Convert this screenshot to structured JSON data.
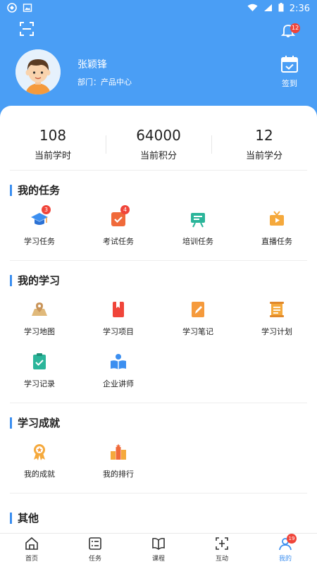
{
  "status_bar": {
    "time": "2:36"
  },
  "header": {
    "user_name": "张颖锋",
    "department": "部门：产品中心",
    "checkin_label": "签到",
    "notification_count": "12"
  },
  "stats": [
    {
      "value": "108",
      "label": "当前学时"
    },
    {
      "value": "64000",
      "label": "当前积分"
    },
    {
      "value": "12",
      "label": "当前学分"
    }
  ],
  "sections": {
    "tasks": {
      "title": "我的任务",
      "items": [
        {
          "label": "学习任务",
          "icon": "graduation-cap-icon",
          "badge": "3"
        },
        {
          "label": "考试任务",
          "icon": "exam-check-icon",
          "badge": "4"
        },
        {
          "label": "培训任务",
          "icon": "training-board-icon"
        },
        {
          "label": "直播任务",
          "icon": "live-tv-icon"
        }
      ]
    },
    "learning": {
      "title": "我的学习",
      "items": [
        {
          "label": "学习地图",
          "icon": "map-icon"
        },
        {
          "label": "学习项目",
          "icon": "project-book-icon"
        },
        {
          "label": "学习笔记",
          "icon": "notes-pen-icon"
        },
        {
          "label": "学习计划",
          "icon": "plan-scroll-icon"
        },
        {
          "label": "学习记录",
          "icon": "record-clipboard-icon"
        },
        {
          "label": "企业讲师",
          "icon": "lecturer-icon"
        }
      ]
    },
    "achievements": {
      "title": "学习成就",
      "items": [
        {
          "label": "我的成就",
          "icon": "medal-icon"
        },
        {
          "label": "我的排行",
          "icon": "ranking-icon"
        }
      ]
    },
    "other": {
      "title": "其他"
    }
  },
  "tabbar": {
    "items": [
      {
        "label": "首页",
        "icon": "home-icon"
      },
      {
        "label": "任务",
        "icon": "task-list-icon"
      },
      {
        "label": "课程",
        "icon": "course-book-icon"
      },
      {
        "label": "互动",
        "icon": "interact-icon"
      },
      {
        "label": "我的",
        "icon": "profile-icon",
        "badge": "19",
        "active": true
      }
    ]
  },
  "colors": {
    "header_blue": "#4a9ef5",
    "accent_blue": "#3c8ff0",
    "badge_red": "#f0453a",
    "icon_orange": "#f59a3c",
    "icon_teal": "#2bb59a",
    "icon_blue": "#3c8ff0"
  }
}
